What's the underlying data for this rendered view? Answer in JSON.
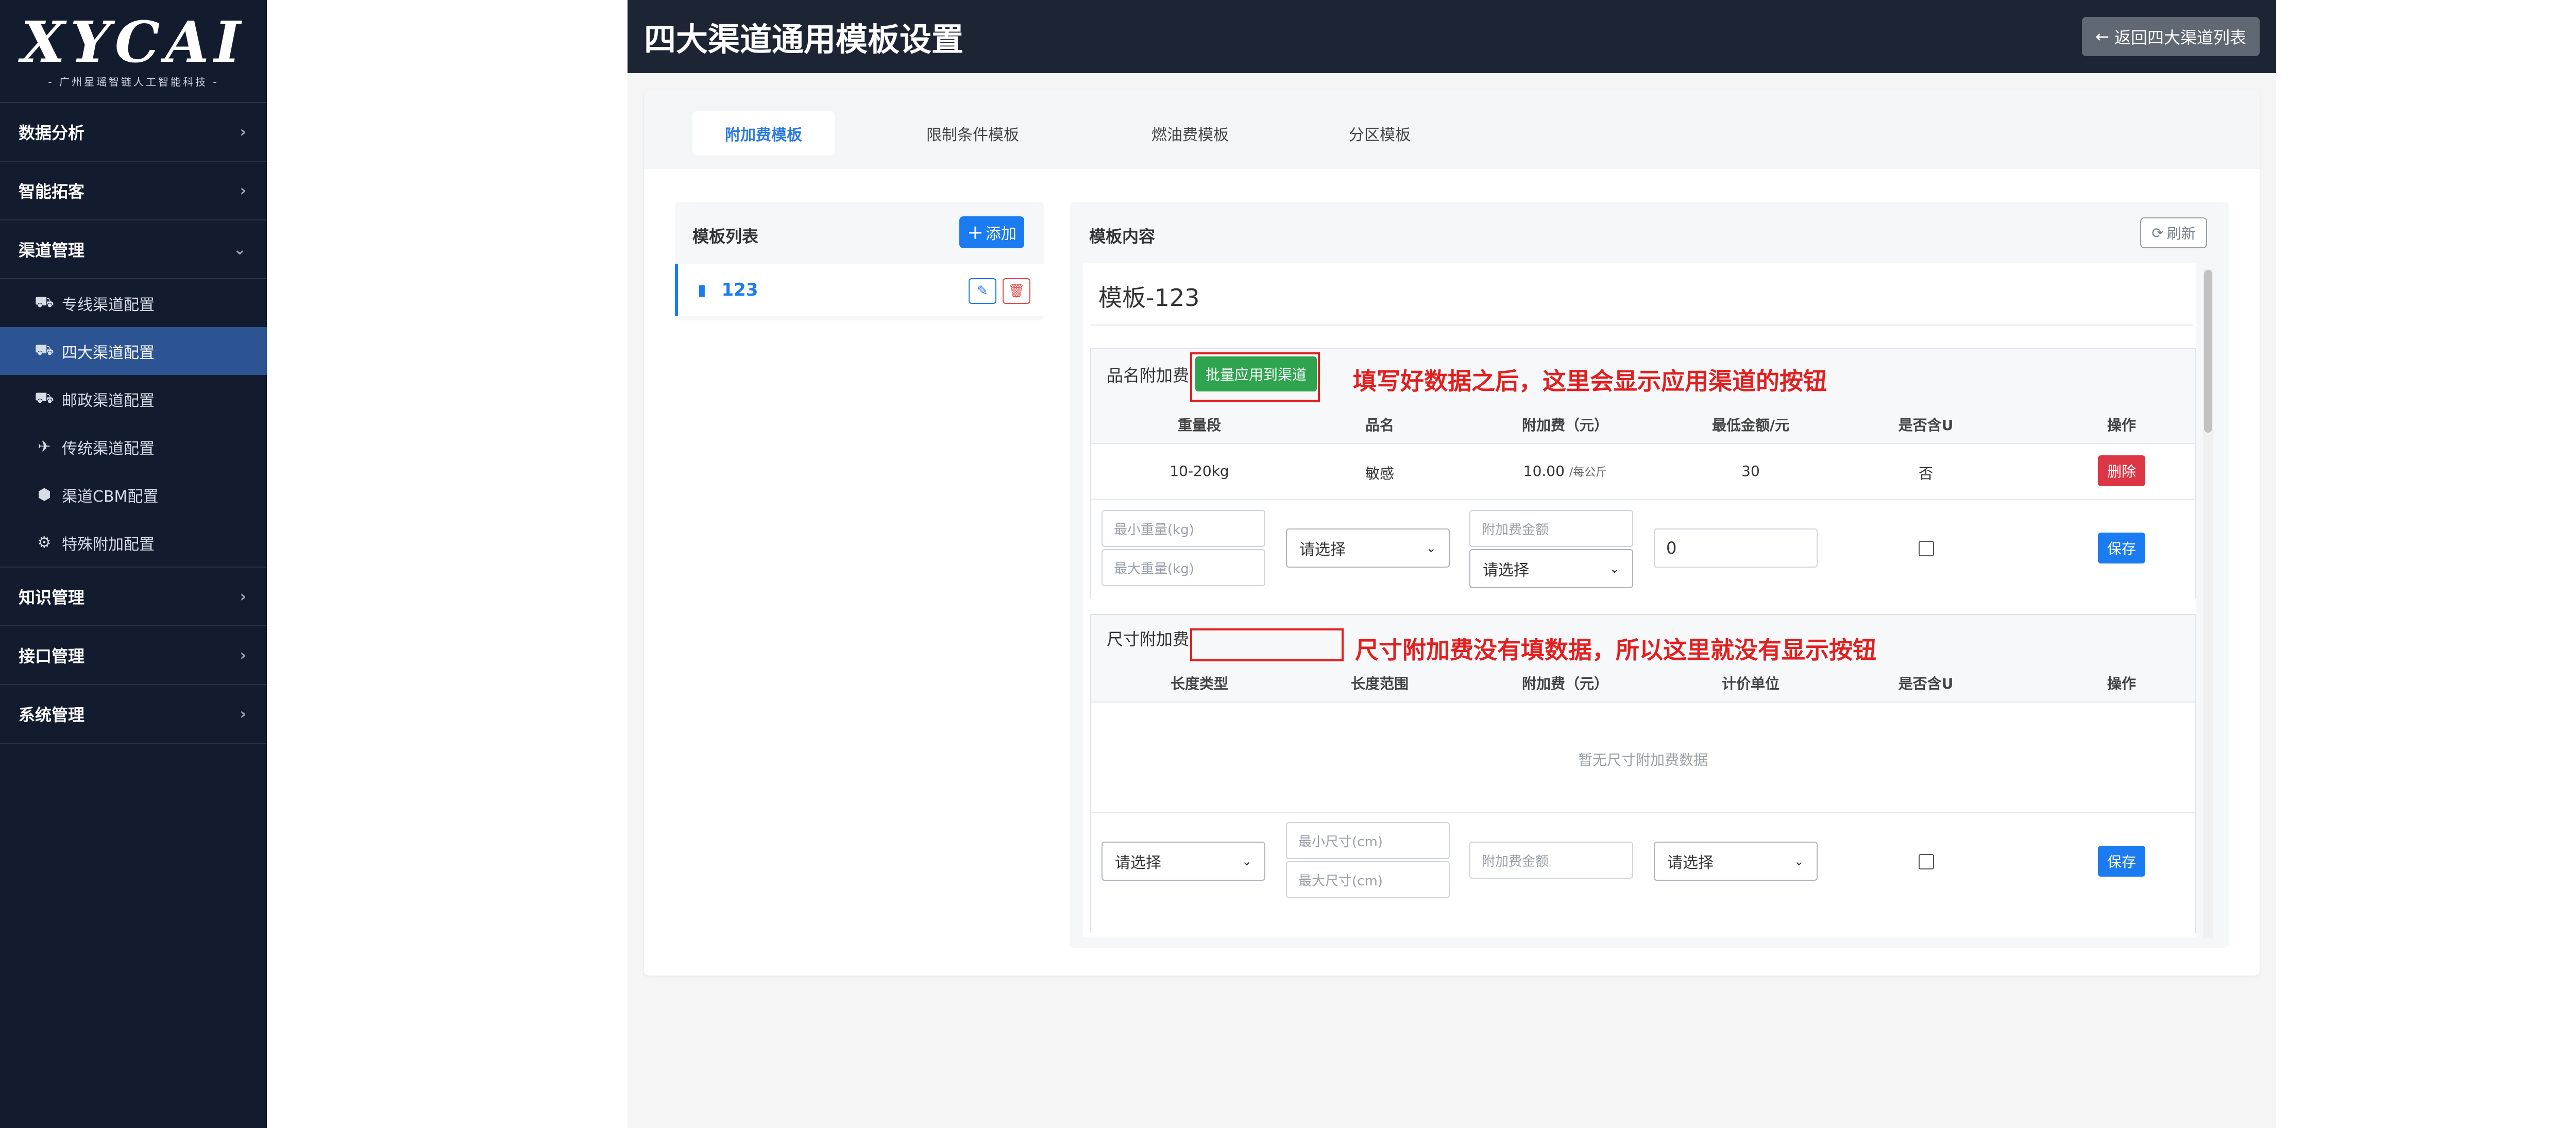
{
  "sidebar": {
    "logo_text": "XYCAI",
    "logo_subtitle": "- 广州星瑶智链人工智能科技 -",
    "groups": [
      {
        "label": "数据分析",
        "chevron": "›"
      },
      {
        "label": "智能拓客",
        "chevron": "›"
      },
      {
        "label": "渠道管理",
        "chevron": "⌄"
      },
      {
        "label": "知识管理",
        "chevron": "›"
      },
      {
        "label": "接口管理",
        "chevron": "›"
      },
      {
        "label": "系统管理",
        "chevron": "›"
      }
    ],
    "sub_items": [
      {
        "label": "专线渠道配置",
        "icon": "truck-icon",
        "glyph": "⛟"
      },
      {
        "label": "四大渠道配置",
        "icon": "truck-icon",
        "glyph": "⛟"
      },
      {
        "label": "邮政渠道配置",
        "icon": "truck-icon",
        "glyph": "⛟"
      },
      {
        "label": "传统渠道配置",
        "icon": "plane-icon",
        "glyph": "✈"
      },
      {
        "label": "渠道CBM配置",
        "icon": "box-icon",
        "glyph": "⬢"
      },
      {
        "label": "特殊附加配置",
        "icon": "gear-icon",
        "glyph": "⚙"
      }
    ]
  },
  "header": {
    "title": "四大渠道通用模板设置",
    "back_label": "返回四大渠道列表"
  },
  "tabs": [
    "附加费模板",
    "限制条件模板",
    "燃油费模板",
    "分区模板"
  ],
  "template_list": {
    "title": "模板列表",
    "add_label": "添加",
    "items": [
      {
        "name": "123"
      }
    ]
  },
  "template_content": {
    "title": "模板内容",
    "refresh_label": "刷新",
    "heading": "模板-123",
    "name_fee": {
      "label": "品名附加费",
      "batch_button": "批量应用到渠道",
      "columns": [
        "重量段",
        "品名",
        "附加费（元）",
        "最低金额/元",
        "是否含U",
        "操作"
      ],
      "rows": [
        {
          "weight": "10-20kg",
          "name": "敏感",
          "fee": "10.00",
          "fee_unit": "/每公斤",
          "min": "30",
          "include_u": "否",
          "action": "删除"
        }
      ],
      "form": {
        "min_weight_placeholder": "最小重量(kg)",
        "max_weight_placeholder": "最大重量(kg)",
        "name_select": "请选择",
        "fee_placeholder": "附加费金额",
        "unit_select": "请选择",
        "min_value": "0",
        "save": "保存"
      }
    },
    "size_fee": {
      "label": "尺寸附加费",
      "columns": [
        "长度类型",
        "长度范围",
        "附加费（元）",
        "计价单位",
        "是否含U",
        "操作"
      ],
      "empty_text": "暂无尺寸附加费数据",
      "form": {
        "length_type_select": "请选择",
        "min_size_placeholder": "最小尺寸(cm)",
        "max_size_placeholder": "最大尺寸(cm)",
        "fee_placeholder": "附加费金额",
        "unit_select": "请选择",
        "save": "保存"
      }
    }
  },
  "annotations": {
    "note1": "填写好数据之后，这里会显示应用渠道的按钮",
    "note2": "尺寸附加费没有填数据，所以这里就没有显示按钮"
  },
  "colors": {
    "sidebar_bg": "#131c2e",
    "sidebar_active": "#2c5392",
    "header_bg": "#1d2535",
    "primary": "#1b7bf0",
    "danger": "#dc3545",
    "success": "#2ea44f",
    "annotation": "#e21f1f"
  }
}
